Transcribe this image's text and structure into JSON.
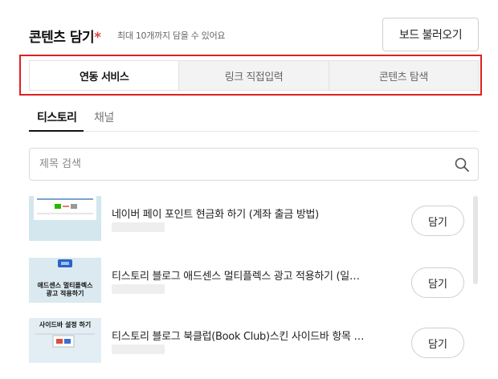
{
  "header": {
    "title": "콘텐츠 담기",
    "required_mark": "*",
    "subtitle": "최대 10개까지 담을 수 있어요",
    "load_board_button": "보드 불러오기"
  },
  "tabs": [
    {
      "label": "연동 서비스",
      "active": true
    },
    {
      "label": "링크 직접입력",
      "active": false
    },
    {
      "label": "콘텐츠 탐색",
      "active": false
    }
  ],
  "subtabs": [
    {
      "label": "티스토리",
      "active": true
    },
    {
      "label": "채널",
      "active": false
    }
  ],
  "search": {
    "placeholder": "제목 검색",
    "icon": "search-icon"
  },
  "items": [
    {
      "title": "네이버 페이 포인트 현금화 하기 (계좌 출금 방법)",
      "thumb_text": "",
      "action": "담기"
    },
    {
      "title": "티스토리 블로그 애드센스 멀티플렉스 광고 적용하기 (일…",
      "thumb_text_1": "애드센스 멀티플렉스",
      "thumb_text_2": "광고 적용하기",
      "action": "담기"
    },
    {
      "title": "티스토리 블로그 북클럽(Book Club)스킨 사이드바 항목 …",
      "thumb_text_1": "사이드바 설정 하기",
      "action": "담기"
    }
  ],
  "colors": {
    "highlight_border": "#e02020",
    "required_mark": "#e2463a",
    "thumb_bg": "#cfe3ec"
  }
}
